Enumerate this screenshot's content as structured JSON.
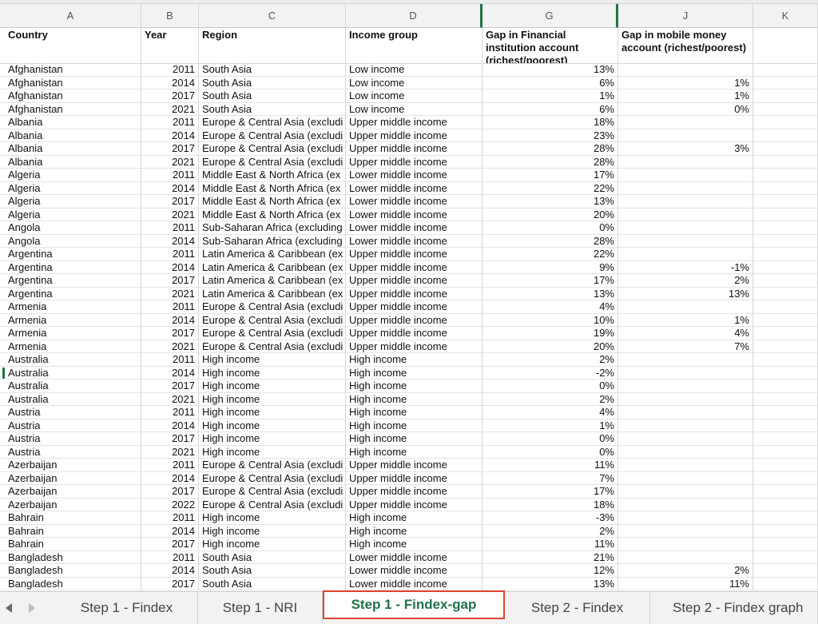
{
  "columns": [
    "A",
    "B",
    "C",
    "D",
    "G",
    "J",
    "K"
  ],
  "headers": {
    "country": "Country",
    "year": "Year",
    "region": "Region",
    "income_group": "Income group",
    "gap_fi": "Gap in Financial institution account (richest/poorest)",
    "gap_mm": "Gap in mobile money account (richest/poorest)"
  },
  "rows": [
    {
      "country": "Afghanistan",
      "year": "2011",
      "region": "South Asia",
      "income": "Low income",
      "gap_fi": "13%",
      "gap_mm": ""
    },
    {
      "country": "Afghanistan",
      "year": "2014",
      "region": "South Asia",
      "income": "Low income",
      "gap_fi": "6%",
      "gap_mm": "1%"
    },
    {
      "country": "Afghanistan",
      "year": "2017",
      "region": "South Asia",
      "income": "Low income",
      "gap_fi": "1%",
      "gap_mm": "1%"
    },
    {
      "country": "Afghanistan",
      "year": "2021",
      "region": "South Asia",
      "income": "Low income",
      "gap_fi": "6%",
      "gap_mm": "0%"
    },
    {
      "country": "Albania",
      "year": "2011",
      "region": "Europe & Central Asia (excludi",
      "income": "Upper middle income",
      "gap_fi": "18%",
      "gap_mm": ""
    },
    {
      "country": "Albania",
      "year": "2014",
      "region": "Europe & Central Asia (excludi",
      "income": "Upper middle income",
      "gap_fi": "23%",
      "gap_mm": ""
    },
    {
      "country": "Albania",
      "year": "2017",
      "region": "Europe & Central Asia (excludi",
      "income": "Upper middle income",
      "gap_fi": "28%",
      "gap_mm": "3%"
    },
    {
      "country": "Albania",
      "year": "2021",
      "region": "Europe & Central Asia (excludi",
      "income": "Upper middle income",
      "gap_fi": "28%",
      "gap_mm": ""
    },
    {
      "country": "Algeria",
      "year": "2011",
      "region": "Middle East & North Africa (ex",
      "income": "Lower middle income",
      "gap_fi": "17%",
      "gap_mm": ""
    },
    {
      "country": "Algeria",
      "year": "2014",
      "region": "Middle East & North Africa (ex",
      "income": "Lower middle income",
      "gap_fi": "22%",
      "gap_mm": ""
    },
    {
      "country": "Algeria",
      "year": "2017",
      "region": "Middle East & North Africa (ex",
      "income": "Lower middle income",
      "gap_fi": "13%",
      "gap_mm": ""
    },
    {
      "country": "Algeria",
      "year": "2021",
      "region": "Middle East & North Africa (ex",
      "income": "Lower middle income",
      "gap_fi": "20%",
      "gap_mm": ""
    },
    {
      "country": "Angola",
      "year": "2011",
      "region": "Sub-Saharan Africa (excluding",
      "income": "Lower middle income",
      "gap_fi": "0%",
      "gap_mm": ""
    },
    {
      "country": "Angola",
      "year": "2014",
      "region": "Sub-Saharan Africa (excluding",
      "income": "Lower middle income",
      "gap_fi": "28%",
      "gap_mm": ""
    },
    {
      "country": "Argentina",
      "year": "2011",
      "region": "Latin America & Caribbean (ex",
      "income": "Upper middle income",
      "gap_fi": "22%",
      "gap_mm": ""
    },
    {
      "country": "Argentina",
      "year": "2014",
      "region": "Latin America & Caribbean (ex",
      "income": "Upper middle income",
      "gap_fi": "9%",
      "gap_mm": "-1%"
    },
    {
      "country": "Argentina",
      "year": "2017",
      "region": "Latin America & Caribbean (ex",
      "income": "Upper middle income",
      "gap_fi": "17%",
      "gap_mm": "2%"
    },
    {
      "country": "Argentina",
      "year": "2021",
      "region": "Latin America & Caribbean (ex",
      "income": "Upper middle income",
      "gap_fi": "13%",
      "gap_mm": "13%"
    },
    {
      "country": "Armenia",
      "year": "2011",
      "region": "Europe & Central Asia (excludi",
      "income": "Upper middle income",
      "gap_fi": "4%",
      "gap_mm": ""
    },
    {
      "country": "Armenia",
      "year": "2014",
      "region": "Europe & Central Asia (excludi",
      "income": "Upper middle income",
      "gap_fi": "10%",
      "gap_mm": "1%"
    },
    {
      "country": "Armenia",
      "year": "2017",
      "region": "Europe & Central Asia (excludi",
      "income": "Upper middle income",
      "gap_fi": "19%",
      "gap_mm": "4%"
    },
    {
      "country": "Armenia",
      "year": "2021",
      "region": "Europe & Central Asia (excludi",
      "income": "Upper middle income",
      "gap_fi": "20%",
      "gap_mm": "7%"
    },
    {
      "country": "Australia",
      "year": "2011",
      "region": "High income",
      "income": "High income",
      "gap_fi": "2%",
      "gap_mm": ""
    },
    {
      "country": "Australia",
      "year": "2014",
      "region": "High income",
      "income": "High income",
      "gap_fi": "-2%",
      "gap_mm": ""
    },
    {
      "country": "Australia",
      "year": "2017",
      "region": "High income",
      "income": "High income",
      "gap_fi": "0%",
      "gap_mm": ""
    },
    {
      "country": "Australia",
      "year": "2021",
      "region": "High income",
      "income": "High income",
      "gap_fi": "2%",
      "gap_mm": ""
    },
    {
      "country": "Austria",
      "year": "2011",
      "region": "High income",
      "income": "High income",
      "gap_fi": "4%",
      "gap_mm": ""
    },
    {
      "country": "Austria",
      "year": "2014",
      "region": "High income",
      "income": "High income",
      "gap_fi": "1%",
      "gap_mm": ""
    },
    {
      "country": "Austria",
      "year": "2017",
      "region": "High income",
      "income": "High income",
      "gap_fi": "0%",
      "gap_mm": ""
    },
    {
      "country": "Austria",
      "year": "2021",
      "region": "High income",
      "income": "High income",
      "gap_fi": "0%",
      "gap_mm": ""
    },
    {
      "country": "Azerbaijan",
      "year": "2011",
      "region": "Europe & Central Asia (excludi",
      "income": "Upper middle income",
      "gap_fi": "11%",
      "gap_mm": ""
    },
    {
      "country": "Azerbaijan",
      "year": "2014",
      "region": "Europe & Central Asia (excludi",
      "income": "Upper middle income",
      "gap_fi": "7%",
      "gap_mm": ""
    },
    {
      "country": "Azerbaijan",
      "year": "2017",
      "region": "Europe & Central Asia (excludi",
      "income": "Upper middle income",
      "gap_fi": "17%",
      "gap_mm": ""
    },
    {
      "country": "Azerbaijan",
      "year": "2022",
      "region": "Europe & Central Asia (excludi",
      "income": "Upper middle income",
      "gap_fi": "18%",
      "gap_mm": ""
    },
    {
      "country": "Bahrain",
      "year": "2011",
      "region": "High income",
      "income": "High income",
      "gap_fi": "-3%",
      "gap_mm": ""
    },
    {
      "country": "Bahrain",
      "year": "2014",
      "region": "High income",
      "income": "High income",
      "gap_fi": "2%",
      "gap_mm": ""
    },
    {
      "country": "Bahrain",
      "year": "2017",
      "region": "High income",
      "income": "High income",
      "gap_fi": "11%",
      "gap_mm": ""
    },
    {
      "country": "Bangladesh",
      "year": "2011",
      "region": "South Asia",
      "income": "Lower middle income",
      "gap_fi": "21%",
      "gap_mm": ""
    },
    {
      "country": "Bangladesh",
      "year": "2014",
      "region": "South Asia",
      "income": "Lower middle income",
      "gap_fi": "12%",
      "gap_mm": "2%"
    },
    {
      "country": "Bangladesh",
      "year": "2017",
      "region": "South Asia",
      "income": "Lower middle income",
      "gap_fi": "13%",
      "gap_mm": "11%"
    }
  ],
  "tabs": [
    {
      "label": "Step 1 - Findex",
      "active": false
    },
    {
      "label": "Step 1 - NRI",
      "active": false
    },
    {
      "label": "Step 1 - Findex-gap",
      "active": true
    },
    {
      "label": "Step 2 - Findex",
      "active": false
    },
    {
      "label": "Step 2 - Findex graph",
      "active": false
    }
  ],
  "nav": {
    "prev_icon": "triangle-left",
    "next_icon": "triangle-right"
  },
  "colors": {
    "accent": "#217346",
    "highlight_border": "#e0452e"
  }
}
